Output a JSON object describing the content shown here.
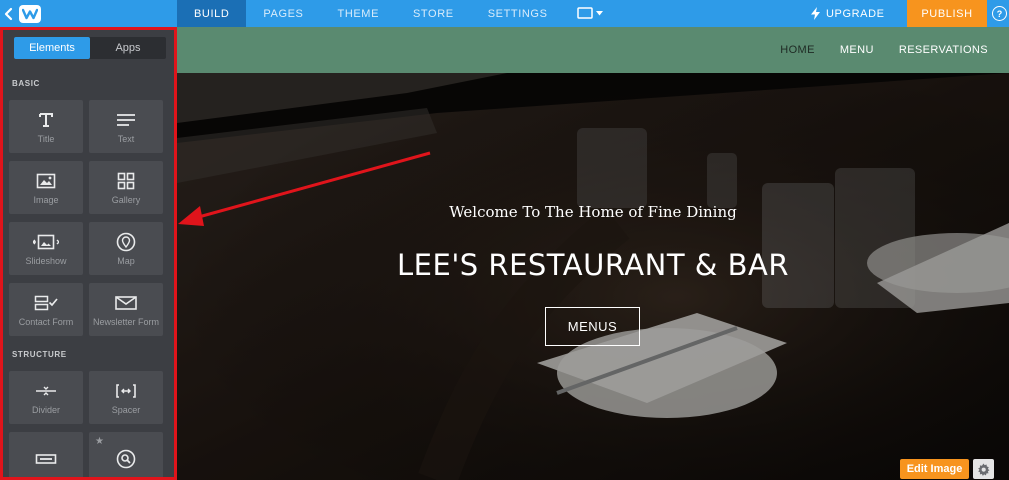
{
  "topbar": {
    "nav": [
      "BUILD",
      "PAGES",
      "THEME",
      "STORE",
      "SETTINGS"
    ],
    "active_index": 0,
    "upgrade_label": "UPGRADE",
    "publish_label": "PUBLISH",
    "help_label": "?"
  },
  "sidebar": {
    "tabs": [
      "Elements",
      "Apps"
    ],
    "active_tab": 0,
    "basic_label": "BASIC",
    "structure_label": "STRUCTURE",
    "basic_items": [
      {
        "label": "Title",
        "icon": "title-icon"
      },
      {
        "label": "Text",
        "icon": "text-icon"
      },
      {
        "label": "Image",
        "icon": "image-icon"
      },
      {
        "label": "Gallery",
        "icon": "gallery-icon"
      },
      {
        "label": "Slideshow",
        "icon": "slideshow-icon"
      },
      {
        "label": "Map",
        "icon": "map-pin-icon"
      },
      {
        "label": "Contact Form",
        "icon": "contact-form-icon"
      },
      {
        "label": "Newsletter Form",
        "icon": "envelope-icon"
      }
    ],
    "structure_items": [
      {
        "label": "Divider",
        "icon": "divider-icon"
      },
      {
        "label": "Spacer",
        "icon": "spacer-icon"
      },
      {
        "label": "",
        "icon": "button-icon"
      },
      {
        "label": "",
        "icon": "search-icon"
      }
    ]
  },
  "site": {
    "nav": [
      "HOME",
      "MENU",
      "RESERVATIONS"
    ],
    "hero_subtitle": "Welcome To The Home of Fine Dining",
    "hero_title": "LEE'S RESTAURANT & BAR",
    "hero_button": "MENUS",
    "edit_image_label": "Edit Image"
  },
  "colors": {
    "topbar": "#2e9be8",
    "active_nav": "#1b6fb5",
    "publish": "#f7941e",
    "sidebar": "#3c3e43",
    "highlight_border": "#e0141b",
    "site_header": "#5a8a70"
  }
}
